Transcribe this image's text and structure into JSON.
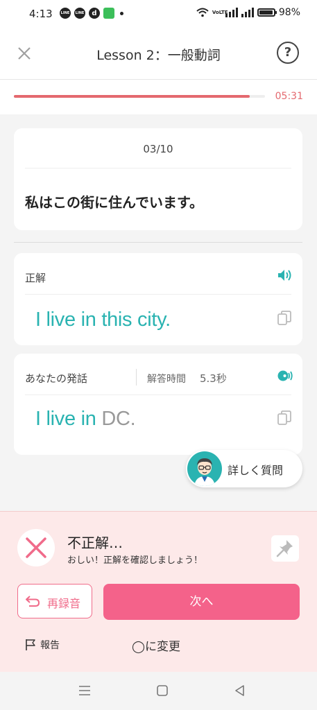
{
  "status_bar": {
    "time": "4:13",
    "notif_icons": [
      "LINE",
      "LINE",
      "d",
      "app"
    ],
    "battery": "98%",
    "battery_level": 0.98
  },
  "header": {
    "title": "Lesson 2：一般動詞",
    "help_glyph": "?"
  },
  "progress": {
    "fraction": 0.94,
    "timer": "05:31"
  },
  "question": {
    "counter": "03/10",
    "text": "私はこの街に住んでいます。"
  },
  "answer_card": {
    "label": "正解",
    "answer": "I live in this city."
  },
  "speech_card": {
    "label": "あなたの発話",
    "time_label": "解答時間",
    "time_value": "5.3秒",
    "correct_part": "I live in",
    "wrong_part": "DC."
  },
  "ask_button": {
    "label": "詳しく質問"
  },
  "result": {
    "title": "不正解…",
    "subtitle": "おしい！正解を確認しましょう！",
    "rerecord_label": "再録音",
    "next_label": "次へ",
    "report_label": "報告",
    "change_label": "◯に変更"
  },
  "colors": {
    "accent_teal": "#2ab3b1",
    "accent_pink": "#f4628a",
    "timer_red": "#e4696f",
    "result_bg": "#fde9e9"
  },
  "icons": {
    "close": "close-icon",
    "help": "help-icon",
    "speaker": "speaker-icon",
    "copy": "copy-icon",
    "pin": "pin-icon",
    "rerecord": "undo-icon",
    "report": "flag-icon"
  }
}
